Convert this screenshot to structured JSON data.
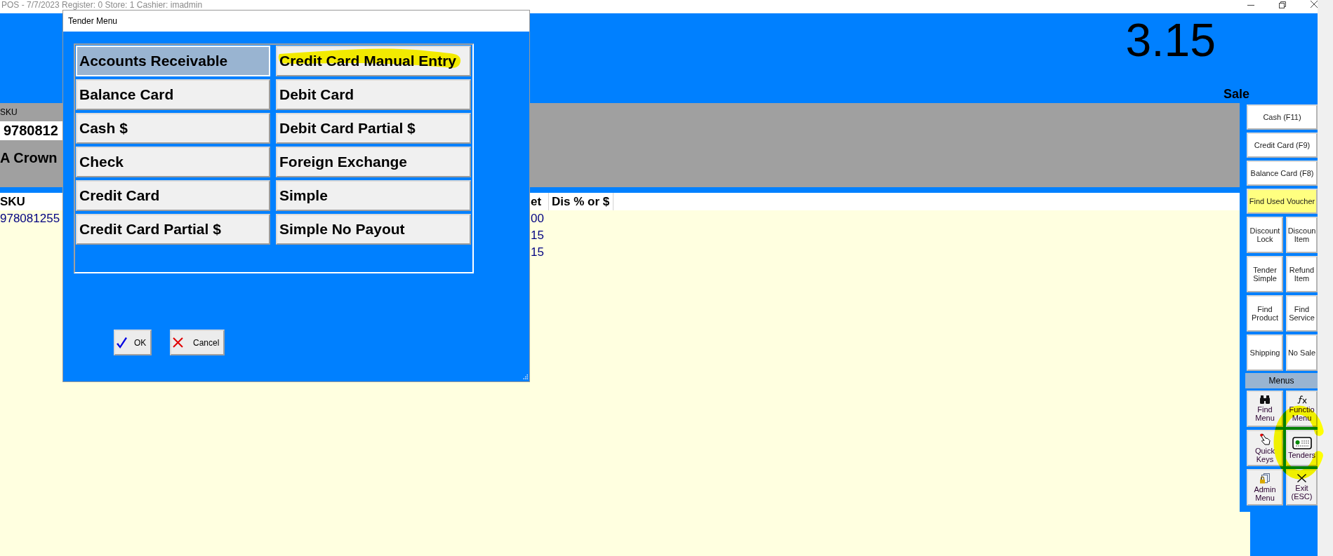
{
  "window": {
    "title": "POS - 7/7/2023 Register: 0 Store: 1 Cashier: imadmin"
  },
  "total": {
    "amount": "3.15",
    "mode": "Sale"
  },
  "entry": {
    "sku_label": "SKU",
    "sku_value": "9780812",
    "description": "A Crown"
  },
  "items_table": {
    "columns": [
      "SKU",
      "et",
      "Dis % or $"
    ],
    "rows": [
      {
        "sku": "978081255",
        "column_2": "00"
      },
      {
        "column_2": "15"
      },
      {
        "column_2": "15"
      }
    ]
  },
  "side_panel": {
    "buttons": [
      {
        "label": "Cash (F11)",
        "kind": "wide",
        "color": "#ffffff"
      },
      {
        "label": "Credit Card (F9)",
        "kind": "wide",
        "color": "#ffffff"
      },
      {
        "label": "Balance Card (F8)",
        "kind": "wide",
        "color": "#ffffff"
      },
      {
        "label": "Find Used Voucher",
        "kind": "wide",
        "color": "#ffff80"
      },
      {
        "label": "Discount Lock",
        "kind": "half",
        "color": "#ffffff"
      },
      {
        "label": "Discoun Item",
        "kind": "half",
        "color": "#ffffff"
      },
      {
        "label": "Tender Simple",
        "kind": "half",
        "color": "#ffffff"
      },
      {
        "label": "Refund Item",
        "kind": "half",
        "color": "#ffffff"
      },
      {
        "label": "Find Product",
        "kind": "half",
        "color": "#ffffff"
      },
      {
        "label": "Find Service",
        "kind": "half",
        "color": "#ffffff"
      },
      {
        "label": "Shipping",
        "kind": "half",
        "color": "#ffffff"
      },
      {
        "label": "No Sale",
        "kind": "half",
        "color": "#ffffff"
      }
    ],
    "menus_label": "Menus",
    "menu_buttons": [
      {
        "label": "Find Menu",
        "circled": false
      },
      {
        "label": "Functio Menu",
        "circled": false
      },
      {
        "label": "Quick Keys",
        "circled": false
      },
      {
        "label": "Tenders",
        "circled": true
      },
      {
        "label": "Admin Menu",
        "circled": false
      },
      {
        "label": "Exit (ESC)",
        "circled": false
      }
    ]
  },
  "tender_dialog": {
    "title": "Tender Menu",
    "options": [
      {
        "label": "Accounts Receivable",
        "selected": true,
        "highlighted": false
      },
      {
        "label": "Credit Card Manual Entry",
        "selected": false,
        "highlighted": true
      },
      {
        "label": "Balance Card",
        "selected": false,
        "highlighted": false
      },
      {
        "label": "Debit Card",
        "selected": false,
        "highlighted": false
      },
      {
        "label": "Cash $",
        "selected": false,
        "highlighted": false
      },
      {
        "label": "Debit Card Partial $",
        "selected": false,
        "highlighted": false
      },
      {
        "label": "Check",
        "selected": false,
        "highlighted": false
      },
      {
        "label": "Foreign Exchange",
        "selected": false,
        "highlighted": false
      },
      {
        "label": "Credit Card",
        "selected": false,
        "highlighted": false
      },
      {
        "label": "Simple",
        "selected": false,
        "highlighted": false
      },
      {
        "label": "Credit Card Partial $",
        "selected": false,
        "highlighted": false
      },
      {
        "label": "Simple No Payout",
        "selected": false,
        "highlighted": false
      }
    ],
    "buttons": [
      {
        "label": "OK",
        "kind": "ok"
      },
      {
        "label": "Cancel",
        "kind": "cancel"
      }
    ]
  }
}
